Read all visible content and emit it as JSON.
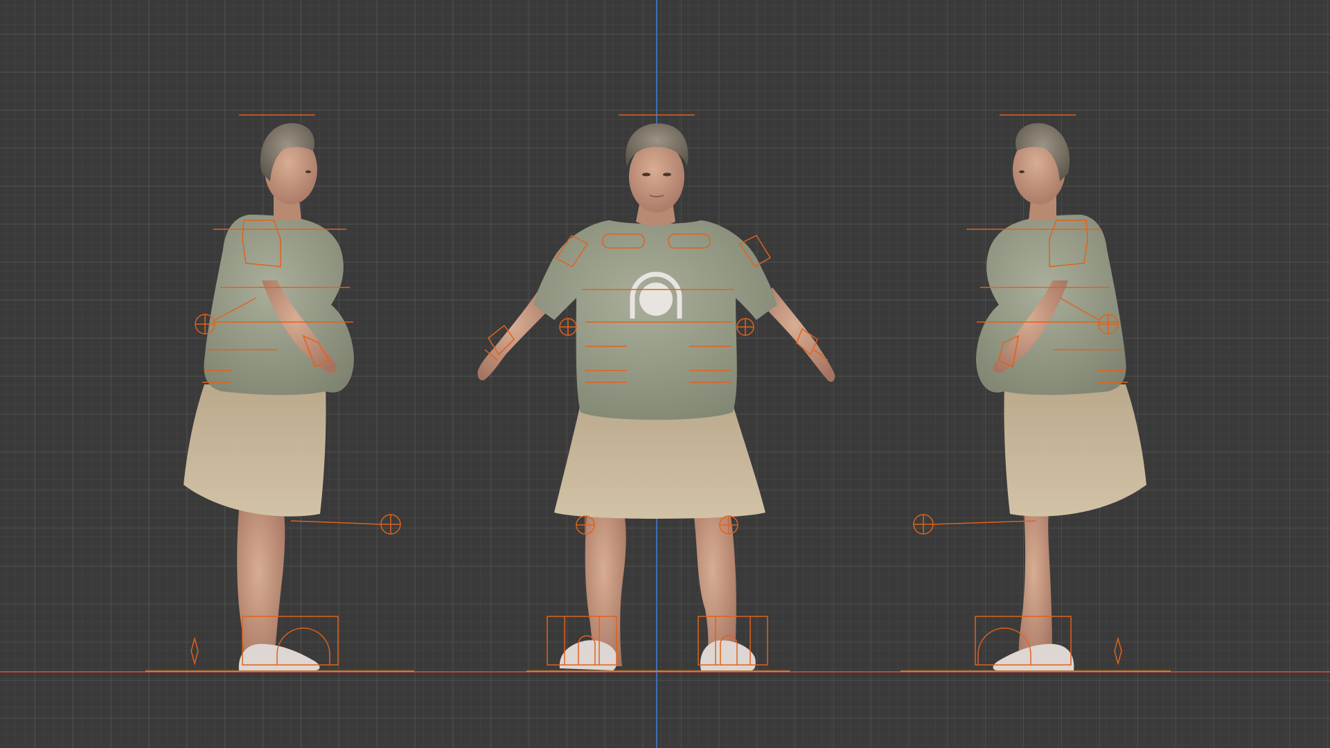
{
  "viewport": {
    "view": "orthographic-front-side-turnaround",
    "grid": true,
    "axis_colors": {
      "x": "#b8483e",
      "z": "#3d6fb8"
    },
    "rig_color": "#e0621c",
    "rig_highlight": "#f08a2a",
    "icons": {
      "ik_target": "circle-cross-icon",
      "floor_pivot": "diamond-icon",
      "root_bone": "arch-icon"
    }
  },
  "character": {
    "views": [
      "side-left",
      "front",
      "side-right"
    ],
    "colors": {
      "skin": "#c99a80",
      "skin_shadow": "#a57461",
      "hair": "#8a8375",
      "hair_dark": "#5e574c",
      "shirt": "#9ea38f",
      "shirt_shadow": "#7d826f",
      "skirt": "#c9b89b",
      "skirt_shadow": "#a8977b",
      "shoe": "#ddd6d2"
    }
  }
}
